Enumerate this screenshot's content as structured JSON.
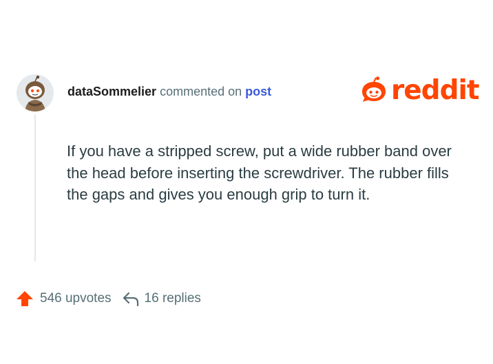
{
  "comment": {
    "username": "dataSommelier",
    "action_text": "commented on",
    "post_link": "post",
    "body": "If you have a stripped screw, put a wide rubber band over the head before inserting the screwdriver. The rubber fills the gaps and gives you enough grip to turn it."
  },
  "brand": {
    "name": "reddit",
    "color": "#ff4500"
  },
  "stats": {
    "upvotes_label": "546 upvotes",
    "replies_label": "16 replies"
  },
  "icons": {
    "avatar": "snoo-avatar",
    "logo": "reddit-snoo-icon",
    "upvote": "upvote-arrow-icon",
    "reply": "reply-arrow-icon"
  },
  "colors": {
    "username": "#1c1c1c",
    "muted_text": "#576f76",
    "link": "#3b5bdb",
    "body_text": "#2a3c42",
    "thread_line": "#e5e7ea",
    "upvote": "#ff4500"
  }
}
